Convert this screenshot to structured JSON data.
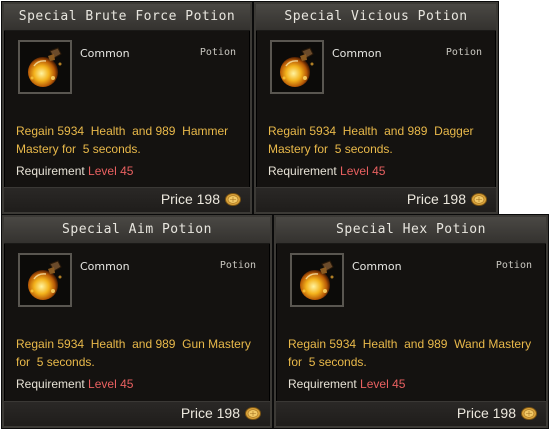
{
  "cards": [
    {
      "title": "Special Brute Force Potion",
      "rarity": "Common",
      "type": "Potion",
      "desc_prefix": "Regain 5934",
      "desc_health": "Health",
      "desc_and": "and 989",
      "desc_mastery": "Hammer Mastery",
      "desc_duration": "for",
      "desc_seconds": "5 seconds.",
      "req_label": "Requirement",
      "req_value": "Level 45",
      "price_label": "Price 198",
      "icon": "potion-icon",
      "coin_icon": "gold-coin-icon"
    },
    {
      "title": "Special Vicious Potion",
      "rarity": "Common",
      "type": "Potion",
      "desc_prefix": "Regain 5934",
      "desc_health": "Health",
      "desc_and": "and 989",
      "desc_mastery": "Dagger Mastery",
      "desc_duration": "for",
      "desc_seconds": "5 seconds.",
      "req_label": "Requirement",
      "req_value": "Level 45",
      "price_label": "Price 198",
      "icon": "potion-icon",
      "coin_icon": "gold-coin-icon"
    },
    {
      "title": "Special Aim Potion",
      "rarity": "Common",
      "type": "Potion",
      "desc_prefix": "Regain 5934",
      "desc_health": "Health",
      "desc_and": "and 989",
      "desc_mastery": "Gun Mastery",
      "desc_duration": "for",
      "desc_seconds": "5 seconds.",
      "req_label": "Requirement",
      "req_value": "Level 45",
      "price_label": "Price 198",
      "icon": "potion-icon",
      "coin_icon": "gold-coin-icon"
    },
    {
      "title": "Special Hex Potion",
      "rarity": "Common",
      "type": "Potion",
      "desc_prefix": "Regain 5934",
      "desc_health": "Health",
      "desc_and": "and 989",
      "desc_mastery": "Wand Mastery",
      "desc_duration": "for",
      "desc_seconds": "5 seconds.",
      "req_label": "Requirement",
      "req_value": "Level 45",
      "price_label": "Price 198",
      "icon": "potion-icon",
      "coin_icon": "gold-coin-icon"
    }
  ],
  "colors": {
    "description": "#e9b94a",
    "requirement_value": "#e86060",
    "panel_bg": "#141210",
    "title_bar": "#4a4844"
  }
}
